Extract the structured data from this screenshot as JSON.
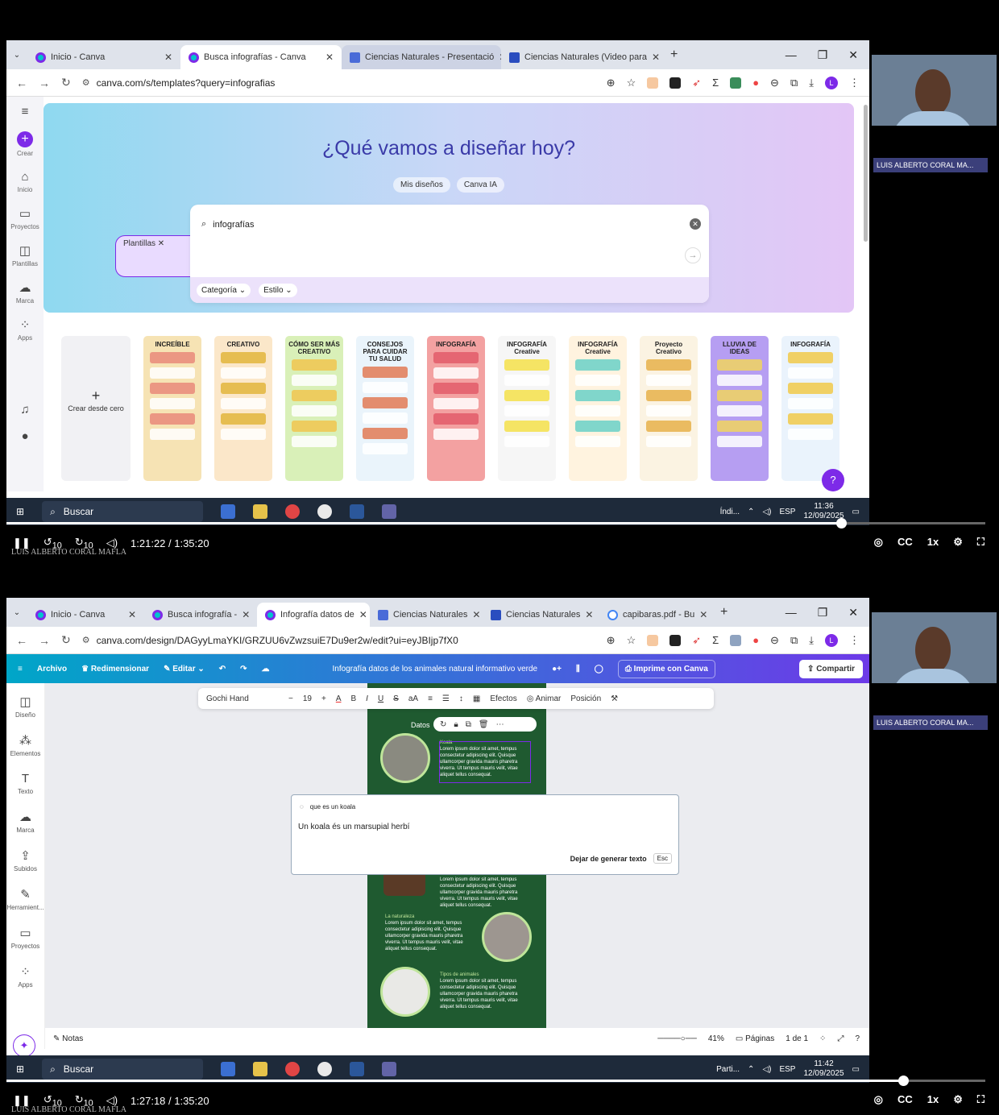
{
  "frame1": {
    "tabs": [
      {
        "label": "Inicio - Canva",
        "icon": "canva-icon",
        "active": false
      },
      {
        "label": "Busca infografías - Canva",
        "icon": "canva-icon",
        "active": true
      },
      {
        "label": "Ciencias Naturales - Presentació",
        "icon": "slides-icon",
        "active": false
      },
      {
        "label": "Ciencias Naturales (Video para",
        "icon": "video-icon",
        "active": false
      }
    ],
    "url": "canva.com/s/templates?query=infografias",
    "rail": [
      {
        "label": "Crear",
        "icon": "plus-icon"
      },
      {
        "label": "Inicio",
        "icon": "home-icon"
      },
      {
        "label": "Proyectos",
        "icon": "folder-icon"
      },
      {
        "label": "Plantillas",
        "icon": "templates-icon"
      },
      {
        "label": "Marca",
        "icon": "brand-icon"
      },
      {
        "label": "Apps",
        "icon": "apps-icon"
      }
    ],
    "hero_title": "¿Qué vamos a diseñar hoy?",
    "chips": [
      "Mis diseños",
      "Plantillas ✕",
      "Canva IA"
    ],
    "search_value": "infografías",
    "filters": [
      "Categoría ⌄",
      "Estilo ⌄"
    ],
    "create_blank": "Crear desde cero",
    "templates": [
      {
        "title": "INCREÍBLE",
        "bg": "#f6e3b4",
        "accent": "#e98a7a"
      },
      {
        "title": "CREATIVO",
        "bg": "#fbe7c9",
        "accent": "#e2b53c"
      },
      {
        "title": "CÓMO SER MÁS CREATIVO",
        "bg": "#d9f0b8",
        "accent": "#f0c64f"
      },
      {
        "title": "CONSEJOS PARA CUIDAR TU SALUD",
        "bg": "#eaf4fb",
        "accent": "#e27a55"
      },
      {
        "title": "INFOGRAFÍA",
        "bg": "#f3a1a1",
        "accent": "#e25c6a"
      },
      {
        "title": "INFOGRAFÍA Creative",
        "bg": "#f6f6f6",
        "accent": "#f4e14a"
      },
      {
        "title": "INFOGRAFÍA Creative",
        "bg": "#fff3df",
        "accent": "#6ad0c8"
      },
      {
        "title": "Proyecto Creativo",
        "bg": "#fbf3e2",
        "accent": "#e6b04a"
      },
      {
        "title": "LLUVIA DE IDEAS",
        "bg": "#b69ef2",
        "accent": "#f1d35f"
      },
      {
        "title": "INFOGRAFÍA",
        "bg": "#eaf3fc",
        "accent": "#f1c94a"
      }
    ],
    "time": "1:21:22 / 1:35:20",
    "progress": 0.853,
    "clock": {
      "time": "11:36",
      "date": "12/09/2025"
    },
    "taskbar_app": "Índi..."
  },
  "frame2": {
    "tabs": [
      {
        "label": "Inicio - Canva",
        "icon": "canva-icon",
        "active": false
      },
      {
        "label": "Busca infografía -",
        "icon": "canva-icon",
        "active": false
      },
      {
        "label": "Infografía datos de",
        "icon": "canva-icon",
        "active": true
      },
      {
        "label": "Ciencias Naturales",
        "icon": "slides-icon",
        "active": false
      },
      {
        "label": "Ciencias Naturales",
        "icon": "video-icon",
        "active": false
      },
      {
        "label": "capibaras.pdf - Bu",
        "icon": "google-icon",
        "active": false
      }
    ],
    "url": "canva.com/design/DAGyyLmaYKI/GRZUU6vZwzsuiE7Du9er2w/edit?ui=eyJBIjp7fX0",
    "toolbar": {
      "file": "Archivo",
      "resize": "Redimensionar",
      "edit": "Editar ⌄",
      "title": "Infografía datos de los animales natural informativo verde",
      "print": "Imprime con Canva",
      "share": "Compartir"
    },
    "rail": [
      {
        "label": "Diseño",
        "icon": "design-icon"
      },
      {
        "label": "Elementos",
        "icon": "elements-icon"
      },
      {
        "label": "Texto",
        "icon": "text-icon"
      },
      {
        "label": "Marca",
        "icon": "brand-icon"
      },
      {
        "label": "Subidos",
        "icon": "upload-icon"
      },
      {
        "label": "Herramient...",
        "icon": "tools-icon"
      },
      {
        "label": "Proyectos",
        "icon": "folder-icon"
      },
      {
        "label": "Apps",
        "icon": "apps-icon"
      }
    ],
    "format": {
      "font": "Gochi Hand",
      "size": "19",
      "effects": "Efectos",
      "animate": "Animar",
      "position": "Posición"
    },
    "poster": {
      "heading": "Datos",
      "sections": [
        "Koala",
        "La naturaleza",
        "Tipos de animales"
      ],
      "lorem": "Lorem ipsum dolor sit amet, tempus consectetur adipiscing elit. Quisque ullamcorper gravida mauris pharetra viverra. Ut tempus mauris velit, vitae aliquet tellus consequat."
    },
    "ai_prompt": "que es un koala",
    "ai_output": "Un koala és un marsupial herbí",
    "ai_stop": "Dejar de generar texto",
    "ai_esc": "Esc",
    "footer": {
      "notes": "Notas",
      "zoom": "41%",
      "pages": "Páginas",
      "page_count": "1 de 1"
    },
    "time": "1:27:18 / 1:35:20",
    "progress": 0.916,
    "clock": {
      "time": "11:42",
      "date": "12/09/2025"
    },
    "taskbar_app": "Parti..."
  },
  "common": {
    "taskbar_search": "Buscar",
    "participant": "LUIS ALBERTO CORAL MA...",
    "watermark": "LUIS ALBERTO CORAL MAFLA",
    "lang": "ESP",
    "speed": "1x",
    "skip_back": "10",
    "skip_fwd": "10"
  }
}
